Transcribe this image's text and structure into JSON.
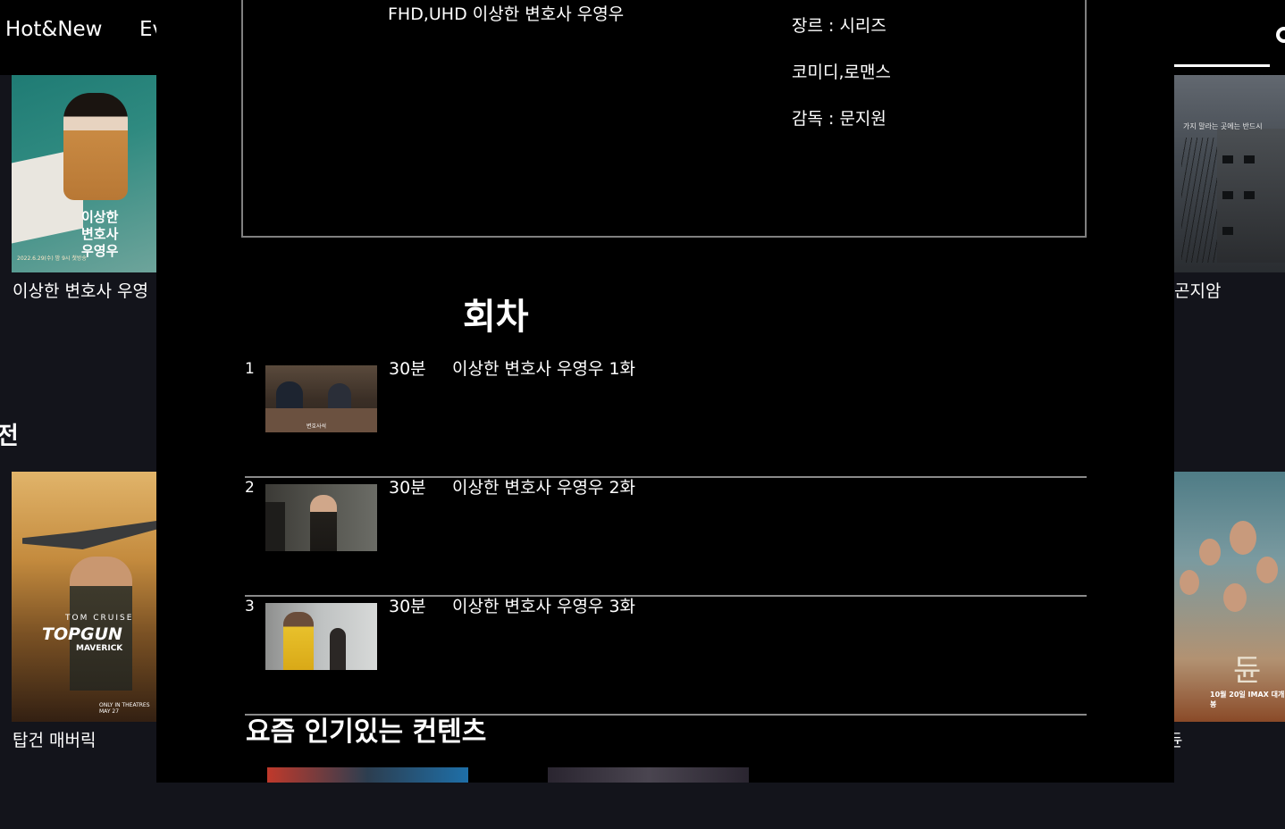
{
  "nav": {
    "items": [
      "Hot&New",
      "Ev"
    ]
  },
  "background": {
    "row1": {
      "left_title": "이상한 변호사 우영",
      "right_title": "곤지암"
    },
    "row2": {
      "heading": "전",
      "left_title": "탑건 매버릭",
      "right_title": "듄"
    },
    "poster_text": {
      "woo_title": "이상한\n변호사\n우영우",
      "woo_date": "2022.6.29(수) 밤 9시 첫방송",
      "gon_tag": "가지 말라는 곳에는 반드시",
      "top_actor": "TOM CRUISE",
      "top_title": "TOPGUN",
      "top_sub": "MAVERICK",
      "top_release": "ONLY IN THEATRES MAY 27",
      "dune_title": "듄",
      "dune_release": "10월 20일 IMAX 대개봉"
    }
  },
  "modal": {
    "quality_title": "FHD,UHD 이상한 변호사 우영우",
    "meta": {
      "genre": "장르 : 시리즈",
      "tags": "코미디,로맨스",
      "director": "감독 : 문지원"
    },
    "episodes_heading": "회차",
    "episodes": [
      {
        "num": "1",
        "duration": "30분",
        "title": "이상한 변호사 우영우 1화",
        "caption": "변호사석"
      },
      {
        "num": "2",
        "duration": "30분",
        "title": "이상한 변호사 우영우 2화"
      },
      {
        "num": "3",
        "duration": "30분",
        "title": "이상한 변호사 우영우 3화"
      }
    ],
    "popular_heading": "요즘 인기있는 컨텐츠"
  },
  "colors": {
    "page_bg": "#13141b",
    "modal_bg": "#000000",
    "divider": "#8a8a8a",
    "text": "#ffffff"
  }
}
